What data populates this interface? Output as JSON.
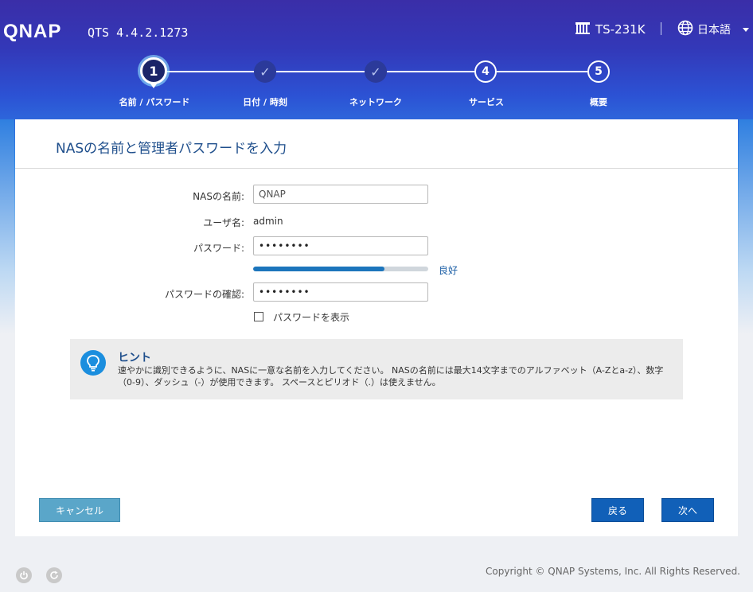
{
  "header": {
    "logo": "QNAP",
    "version": "QTS 4.4.2.1273",
    "device_name": "TS-231K",
    "device_icon": "nas-device-icon",
    "language": "日本語",
    "language_icon": "globe-icon"
  },
  "stepper": {
    "active_step": 1,
    "steps": [
      {
        "number": "1",
        "label": "名前 / パスワード",
        "state": "active"
      },
      {
        "number": "✓",
        "label": "日付 / 時刻",
        "state": "done"
      },
      {
        "number": "✓",
        "label": "ネットワーク",
        "state": "done"
      },
      {
        "number": "4",
        "label": "サービス",
        "state": "todo"
      },
      {
        "number": "5",
        "label": "概要",
        "state": "todo"
      }
    ]
  },
  "panel": {
    "title": "NASの名前と管理者パスワードを入力"
  },
  "form": {
    "nas_name_label": "NASの名前:",
    "nas_name_value": "QNAP",
    "username_label": "ユーザ名:",
    "username_value": "admin",
    "password_label": "パスワード:",
    "password_value": "••••••••",
    "strength_text": "良好",
    "strength_fraction": 0.75,
    "confirm_label": "パスワードの確認:",
    "confirm_value": "••••••••",
    "show_password_label": "パスワードを表示",
    "show_password_checked": false
  },
  "hint": {
    "icon": "lightbulb-icon",
    "title": "ヒント",
    "text": "速やかに識別できるように、NASに一意な名前を入力してください。 NASの名前には最大14文字までのアルファベット（A-Zとa-z）、数字（0-9）、ダッシュ（-）が使用できます。 スペースとピリオド（.）は使えません。"
  },
  "buttons": {
    "cancel": "キャンセル",
    "back": "戻る",
    "next": "次へ"
  },
  "footer": {
    "power_icon": "power-icon",
    "restart_icon": "restart-icon",
    "copyright": "Copyright © QNAP Systems, Inc. All Rights Reserved."
  },
  "colors": {
    "primary_button": "#1160b8",
    "cancel_button": "#5aa6c9",
    "title_text": "#1f4f8c",
    "strength_bar": "#1c75bc"
  }
}
